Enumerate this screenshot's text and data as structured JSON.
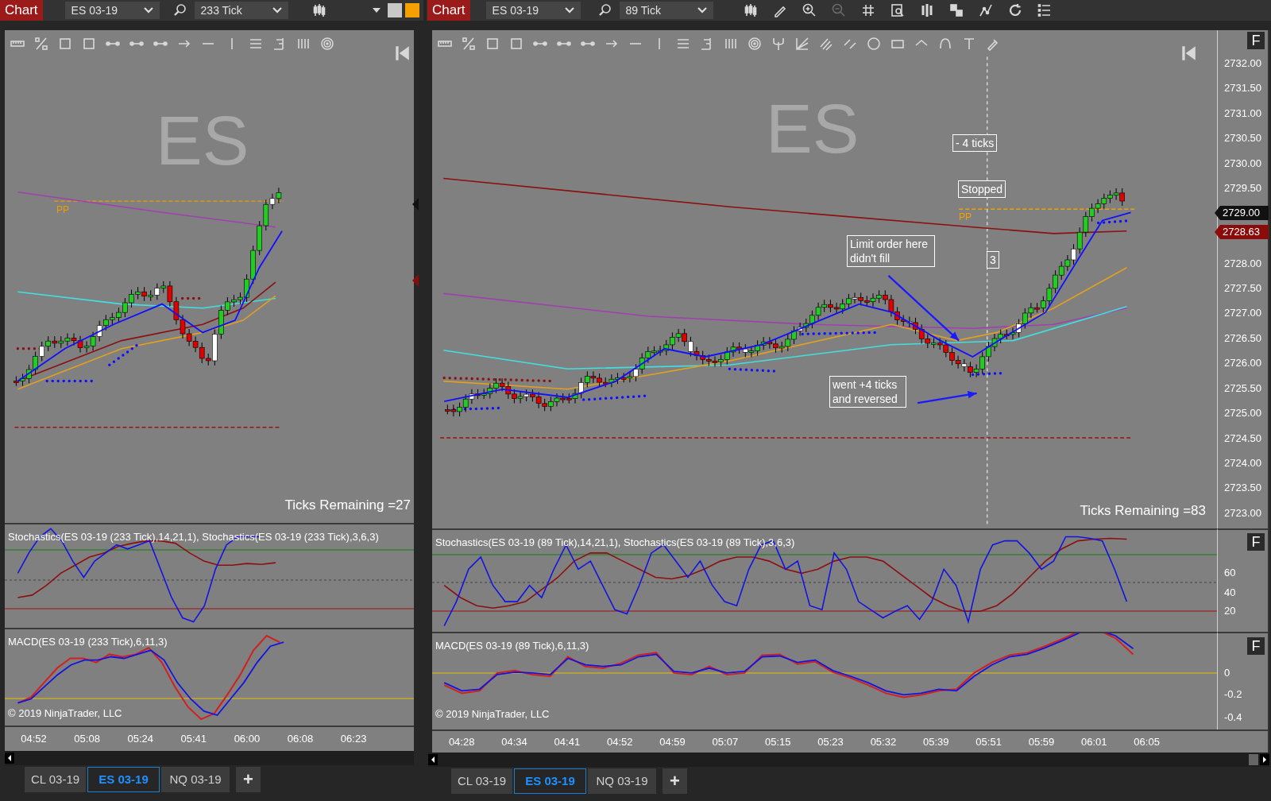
{
  "windows": [
    {
      "chart_button": "Chart",
      "instrument": "ES 03-19",
      "interval": "233 Tick",
      "price_panel": {
        "watermark": "ES",
        "pivot_label": "PP",
        "ticks_remaining": "Ticks Remaining =27"
      },
      "indicators": [
        {
          "kind": "stochastics",
          "label": "Stochastics(ES 03-19 (233 Tick),14,21,1), Stochastics(ES 03-19 (233 Tick),3,6,3)"
        },
        {
          "kind": "macd",
          "label": "MACD(ES 03-19 (233 Tick),6,11,3)",
          "copyright": "© 2019 NinjaTrader, LLC"
        }
      ],
      "time_axis": [
        "04:52",
        "05:08",
        "05:24",
        "05:41",
        "06:00",
        "06:08",
        "06:23"
      ],
      "tabs": [
        {
          "label": "CL 03-19",
          "selected": false
        },
        {
          "label": "ES 03-19",
          "selected": true
        },
        {
          "label": "NQ 03-19",
          "selected": false
        }
      ],
      "add_tab": "+"
    },
    {
      "chart_button": "Chart",
      "instrument": "ES 03-19",
      "interval": "89 Tick",
      "price_panel": {
        "watermark": "ES",
        "pivot_label": "PP",
        "ticks_remaining": "Ticks Remaining =83",
        "annotations": [
          {
            "text": "- 4 ticks"
          },
          {
            "text": "Stopped"
          },
          {
            "text": "Limit order here didn't fill"
          },
          {
            "text": "3"
          },
          {
            "text": "went +4 ticks and reversed"
          }
        ]
      },
      "price_axis": {
        "button": "F",
        "labels": [
          "2732.00",
          "2731.50",
          "2731.00",
          "2730.50",
          "2730.00",
          "2729.50",
          "2728.00",
          "2727.50",
          "2727.00",
          "2726.50",
          "2726.00",
          "2725.50",
          "2725.00",
          "2724.50",
          "2724.00",
          "2723.50",
          "2723.00"
        ],
        "last_price": "2729.00",
        "current_price": "2728.63"
      },
      "indicators": [
        {
          "kind": "stochastics",
          "label": "Stochastics(ES 03-19 (89 Tick),14,21,1), Stochastics(ES 03-19 (89 Tick),3,6,3)",
          "axis_button": "F",
          "axis_labels": [
            "60",
            "40",
            "20"
          ]
        },
        {
          "kind": "macd",
          "label": "MACD(ES 03-19 (89 Tick),6,11,3)",
          "copyright": "© 2019 NinjaTrader, LLC",
          "axis_button": "F",
          "axis_labels": [
            "0",
            "-0.2",
            "-0.4"
          ]
        }
      ],
      "time_axis": [
        "04:28",
        "04:34",
        "04:41",
        "04:52",
        "04:59",
        "05:07",
        "05:15",
        "05:23",
        "05:32",
        "05:39",
        "05:51",
        "05:59",
        "06:01",
        "06:05"
      ],
      "tabs": [
        {
          "label": "CL 03-19",
          "selected": false
        },
        {
          "label": "ES 03-19",
          "selected": true
        },
        {
          "label": "NQ 03-19",
          "selected": false
        }
      ],
      "add_tab": "+"
    }
  ]
}
